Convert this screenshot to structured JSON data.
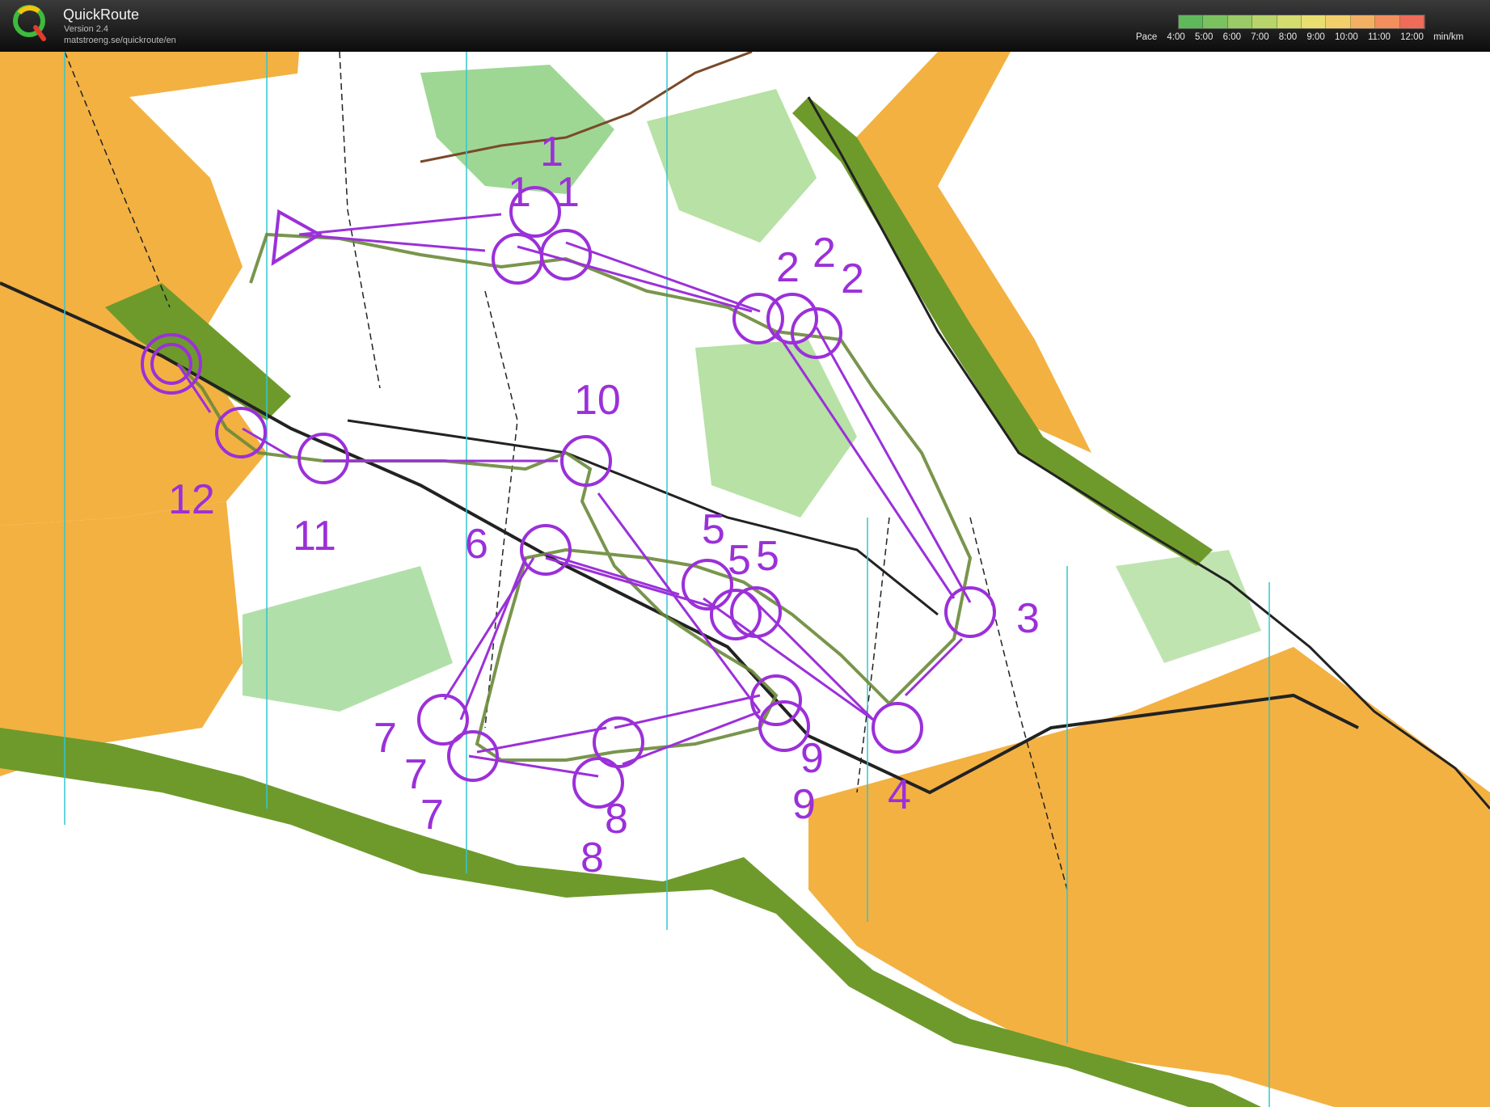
{
  "app": {
    "title": "QuickRoute",
    "version": "Version 2.4",
    "url": "matstroeng.se/quickroute/en",
    "logo_icon": "quickroute-logo-icon"
  },
  "pace_legend": {
    "label": "Pace",
    "ticks": [
      "4:00",
      "5:00",
      "6:00",
      "7:00",
      "8:00",
      "9:00",
      "10:00",
      "11:00",
      "12:00"
    ],
    "unit": "min/km",
    "colors": [
      "#5fb85a",
      "#7cc160",
      "#9acb66",
      "#b8d46b",
      "#d3dc6f",
      "#e8df70",
      "#f2cf6b",
      "#f4b062",
      "#f28f5c",
      "#ef6b5a"
    ]
  },
  "map": {
    "course_color": "#9b30d9",
    "route_color": "#6a8a3a",
    "start_marker": "start-triangle-icon",
    "finish_marker": "finish-double-circle-icon",
    "controls": [
      {
        "label": "1",
        "labels_repeat": [
          "1",
          "1",
          "1"
        ]
      },
      {
        "label": "2",
        "labels_repeat": [
          "2",
          "2",
          "2"
        ]
      },
      {
        "label": "3"
      },
      {
        "label": "4"
      },
      {
        "label": "5",
        "labels_repeat": [
          "5",
          "5",
          "5"
        ]
      },
      {
        "label": "6"
      },
      {
        "label": "7",
        "labels_repeat": [
          "7",
          "7",
          "7"
        ]
      },
      {
        "label": "8",
        "labels_repeat": [
          "8",
          "8"
        ]
      },
      {
        "label": "9",
        "labels_repeat": [
          "9",
          "9"
        ]
      },
      {
        "label": "10"
      },
      {
        "label": "11"
      },
      {
        "label": "12"
      }
    ]
  }
}
